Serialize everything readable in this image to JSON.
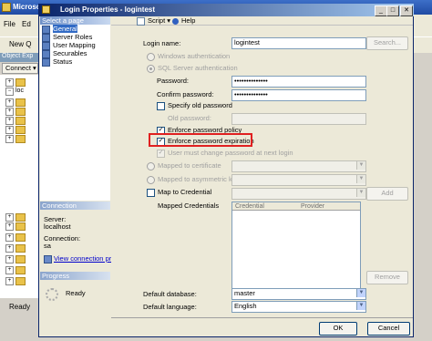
{
  "background_app": {
    "title": "Microso",
    "menu": [
      "File",
      "Ed"
    ],
    "new_query": "New Q",
    "object_explorer_label": "Object Exp",
    "connect_button": "Connect ▾",
    "tree_nodes": [
      "loc"
    ],
    "status": "Ready"
  },
  "dialog": {
    "title": "Login Properties - logintest",
    "controls": {
      "minimize": "_",
      "maximize": "□",
      "close": "✕"
    },
    "select_page_header": "Select a page",
    "pages": [
      "General",
      "Server Roles",
      "User Mapping",
      "Securables",
      "Status"
    ],
    "toolbar": {
      "script": "Script",
      "help": "Help",
      "script_arrow": "▾"
    },
    "connection": {
      "header": "Connection",
      "server_label": "Server:",
      "server_value": "localhost",
      "connection_label": "Connection:",
      "connection_value": "sa",
      "view_link": "View connection properties"
    },
    "progress": {
      "header": "Progress",
      "status": "Ready"
    },
    "form": {
      "login_name_label": "Login name:",
      "login_name_value": "logintest",
      "search_button": "Search...",
      "windows_auth": "Windows authentication",
      "sql_auth": "SQL Server authentication",
      "password_label": "Password:",
      "password_value": "••••••••••••••",
      "confirm_label": "Confirm password:",
      "confirm_value": "••••••••••••••",
      "specify_old": "Specify old password",
      "old_password_label": "Old password:",
      "enforce_policy": "Enforce password policy",
      "enforce_expiration": "Enforce password expiration",
      "must_change": "User must change password at next login",
      "mapped_cert": "Mapped to certificate",
      "mapped_asym": "Mapped to asymmetric key",
      "map_credential": "Map to Credential",
      "add_button": "Add",
      "mapped_credentials_label": "Mapped Credentials",
      "grid_headers": [
        "Credential",
        "Provider"
      ],
      "remove_button": "Remove",
      "default_db_label": "Default database:",
      "default_db_value": "master",
      "default_lang_label": "Default language:",
      "default_lang_value": "English",
      "ok_button": "OK",
      "cancel_button": "Cancel"
    }
  },
  "colors": {
    "highlight_border": "#e02020",
    "title_bar": "#0a246a",
    "selection": "#316ac5"
  }
}
